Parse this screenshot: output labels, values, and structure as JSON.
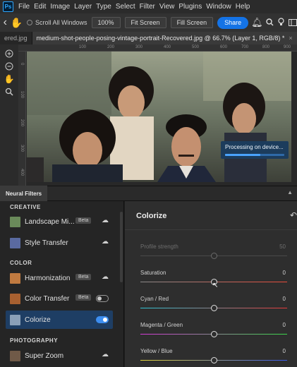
{
  "app": {
    "logo_text": "Ps"
  },
  "menu": [
    "File",
    "Edit",
    "Image",
    "Layer",
    "Type",
    "Select",
    "Filter",
    "View",
    "Plugins",
    "Window",
    "Help"
  ],
  "options": {
    "scroll_all": "Scroll All Windows",
    "zoom": "100%",
    "fit_screen": "Fit Screen",
    "fill_screen": "Fill Screen",
    "share": "Share"
  },
  "tabs": [
    {
      "label": "ered.jpg",
      "active": false
    },
    {
      "label": "medium-shot-people-posing-vintage-portrait-Recovered.jpg @ 66.7% (Layer 1, RGB/8) *",
      "active": true
    }
  ],
  "ruler": {
    "top": [
      "100",
      "200",
      "300",
      "400",
      "500",
      "600",
      "700",
      "800",
      "900"
    ],
    "left": [
      "0",
      "100",
      "200",
      "300",
      "400"
    ]
  },
  "processing": {
    "text": "Processing on device...",
    "progress": 0.6
  },
  "neural": {
    "tab": "Neural Filters",
    "sections": [
      {
        "label": "CREATIVE",
        "items": [
          {
            "name": "Landscape Mi...",
            "beta": "Beta",
            "cloud": true,
            "thumb": "#6a8a5a"
          },
          {
            "name": "Style Transfer",
            "cloud": true,
            "thumb": "#5a6aa0"
          }
        ]
      },
      {
        "label": "COLOR",
        "items": [
          {
            "name": "Harmonization",
            "beta": "Beta",
            "cloud": true,
            "thumb": "#c07a40"
          },
          {
            "name": "Color Transfer",
            "beta": "Beta",
            "toggle": "off",
            "thumb": "#a86030"
          },
          {
            "name": "Colorize",
            "toggle": "on",
            "selected": true,
            "thumb": "#8aa0b8"
          }
        ]
      },
      {
        "label": "PHOTOGRAPHY",
        "items": [
          {
            "name": "Super Zoom",
            "cloud": true,
            "thumb": "#705a48"
          }
        ]
      }
    ]
  },
  "colorize": {
    "title": "Colorize",
    "sliders": [
      {
        "label": "Profile strength",
        "value": "50",
        "dim": true,
        "position": 0.5
      },
      {
        "label": "Saturation",
        "value": "0",
        "dim": false,
        "position": 0.5
      },
      {
        "label": "Cyan / Red",
        "value": "0",
        "dim": false,
        "position": 0.5
      },
      {
        "label": "Magenta / Green",
        "value": "0",
        "dim": false,
        "position": 0.5
      },
      {
        "label": "Yellow / Blue",
        "value": "0",
        "dim": false,
        "position": 0.5
      }
    ]
  },
  "colors": {
    "accent": "#1473e6",
    "selected_row": "#1e3e64",
    "processing_bg": "#1c3c5c"
  }
}
